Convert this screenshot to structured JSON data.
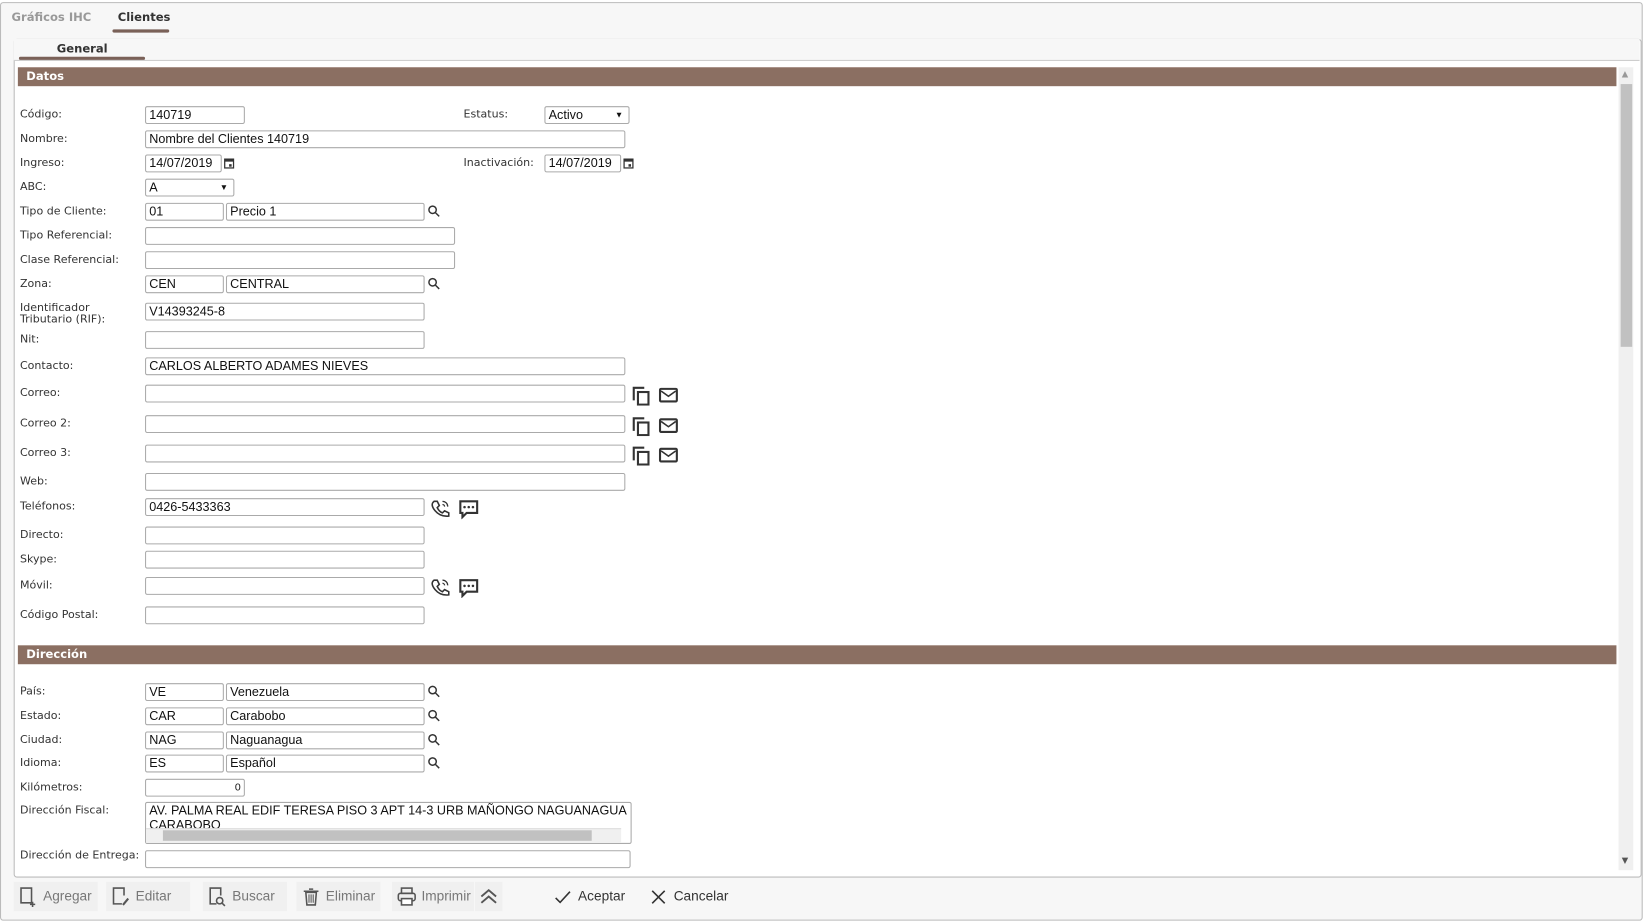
{
  "tabs": [
    {
      "label": "Gráficos IHC",
      "active": false
    },
    {
      "label": "Clientes",
      "active": true
    }
  ],
  "subtab": "General",
  "colors": {
    "section": "#8b6f62",
    "tab_underline": "#7a6158"
  },
  "datos": {
    "title": "Datos",
    "fields": [
      {
        "label": "Código:",
        "value": "140719"
      },
      {
        "label": "Nombre:",
        "value": "Nombre del Clientes 140719"
      },
      {
        "label": "Ingreso:",
        "value": "14/07/2019"
      },
      {
        "label": "ABC:",
        "value": "A"
      },
      {
        "label": "Tipo de Cliente:",
        "value": "01",
        "value2": "Precio 1"
      },
      {
        "label": "Tipo Referencial:",
        "value": ""
      },
      {
        "label": "Clase Referencial:",
        "value": ""
      },
      {
        "label": "Zona:",
        "value": "CEN",
        "value2": "CENTRAL"
      },
      {
        "label": "Identificador Tributario (RIF):",
        "value": "V14393245-8"
      },
      {
        "label": "Nit:",
        "value": ""
      },
      {
        "label": "Contacto:",
        "value": "CARLOS ALBERTO ADAMES NIEVES"
      },
      {
        "label": "Correo:",
        "value": ""
      },
      {
        "label": "Correo 2:",
        "value": ""
      },
      {
        "label": "Correo 3:",
        "value": ""
      },
      {
        "label": "Web:",
        "value": ""
      },
      {
        "label": "Teléfonos:",
        "value": "0426-5433363"
      },
      {
        "label": "Directo:",
        "value": ""
      },
      {
        "label": "Skype:",
        "value": ""
      },
      {
        "label": "Móvil:",
        "value": ""
      },
      {
        "label": "Código Postal:",
        "value": ""
      }
    ],
    "estatus": {
      "label": "Estatus:",
      "value": "Activo"
    },
    "inactivacion": {
      "label": "Inactivación:",
      "value": "14/07/2019"
    }
  },
  "direccion": {
    "title": "Dirección",
    "fields": [
      {
        "label": "País:",
        "value": "VE",
        "value2": "Venezuela"
      },
      {
        "label": "Estado:",
        "value": "CAR",
        "value2": "Carabobo"
      },
      {
        "label": "Ciudad:",
        "value": "NAG",
        "value2": "Naguanagua"
      },
      {
        "label": "Idioma:",
        "value": "ES",
        "value2": "Español"
      },
      {
        "label": "Kilómetros:",
        "value": "0"
      },
      {
        "label": "Dirección Fiscal:",
        "value": "AV. PALMA REAL EDIF TERESA PISO 3 APT 14-3 URB MAÑONGO NAGUANAGUA CARABOBO"
      },
      {
        "label": "Dirección de Entrega:",
        "value": ""
      }
    ]
  },
  "toolbar": {
    "agregar": "Agregar",
    "editar": "Editar",
    "buscar": "Buscar",
    "eliminar": "Eliminar",
    "imprimir": "Imprimir",
    "aceptar": "Aceptar",
    "cancelar": "Cancelar"
  }
}
